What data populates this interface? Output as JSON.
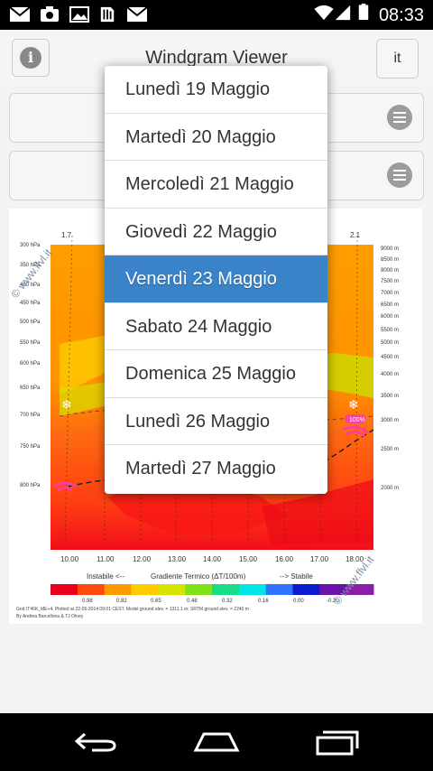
{
  "status_bar": {
    "time": "08:33",
    "icons": [
      "mail-icon",
      "camera-icon",
      "image-icon",
      "sim-icon",
      "mail-icon",
      "wifi-icon",
      "signal-icon",
      "battery-icon"
    ]
  },
  "header": {
    "title": "Windgram Viewer",
    "language_label": "it",
    "info_symbol": "i"
  },
  "dropdown": {
    "selected_index": 4,
    "options": [
      "Lunedì 19 Maggio",
      "Martedì 20 Maggio",
      "Mercoledì 21 Maggio",
      "Giovedì 22 Maggio",
      "Venerdì 23 Maggio",
      "Sabato 24 Maggio",
      "Domenica 25 Maggio",
      "Lunedì 26 Maggio",
      "Martedì 27 Maggio"
    ]
  },
  "windgram": {
    "watermark": "© www.flvl.it",
    "pressure_labels": [
      "300 hPa",
      "350 hPa",
      "400 hPa",
      "450 hPa",
      "500 hPa",
      "550 hPa",
      "600 hPa",
      "650 hPa",
      "700 hPa",
      "750 hPa",
      "800 hPa"
    ],
    "altitude_labels": [
      "9000 m",
      "8500 m",
      "8000 m",
      "7500 m",
      "7000 m",
      "6500 m",
      "6000 m",
      "5500 m",
      "5000 m",
      "4500 m",
      "4000 m",
      "3500 m",
      "3000 m",
      "2500 m",
      "2000 m"
    ],
    "time_labels": [
      "10.00",
      "11.00",
      "12.00",
      "13.00",
      "14.00",
      "15.00",
      "16.00",
      "17.00",
      "18.00"
    ],
    "top_labels": [
      "1.7",
      "2.1"
    ],
    "humidity_label": "100%",
    "gradient_caption_left": "Instabile <--",
    "gradient_caption_mid": "Gradiente Termico (ΔT/100m)",
    "gradient_caption_right": "--> Stabile",
    "colorbar_values": [
      "0.98",
      "0.82",
      "0.65",
      "0.48",
      "0.32",
      "0.16",
      "0.00",
      "-0.20"
    ],
    "colorbar_colors": [
      "#e8001c",
      "#ff4a10",
      "#ff9a00",
      "#ffcc00",
      "#d6e400",
      "#7fe21a",
      "#19dd84",
      "#00e6e6",
      "#2f73ff",
      "#0b1acb",
      "#6c14a8",
      "#8a1ea8"
    ],
    "footer_line1": "Grid IT46K_ME+4. Plotted at 22-05-2014 09:01 CEST. Model ground elev. = 1311.1 m; SRTM ground elev. = 2240 m",
    "footer_line2": "By Andrea Barcellona & TJ Olney"
  }
}
